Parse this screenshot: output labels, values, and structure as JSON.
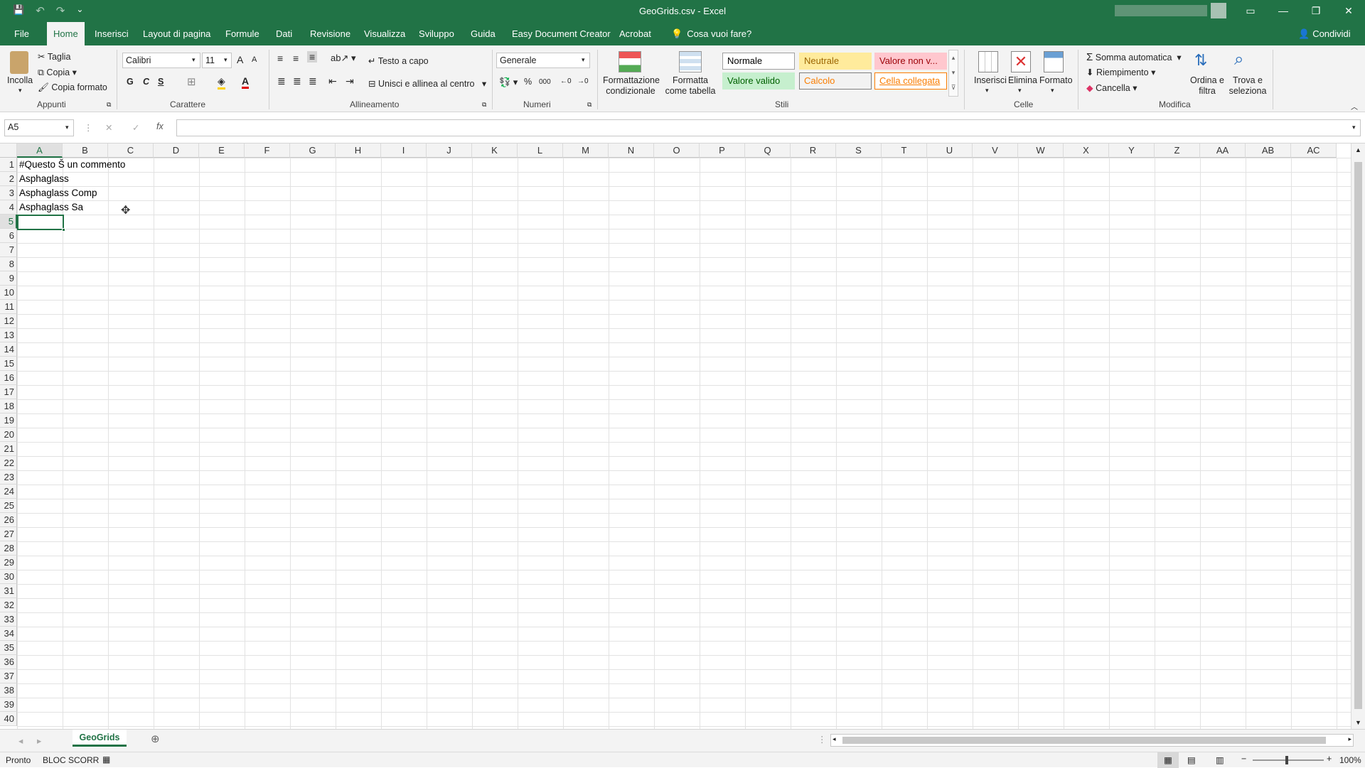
{
  "window": {
    "title": "GeoGrids.csv  -  Excel",
    "controls": {
      "ribbon_display": "▭",
      "minimize": "—",
      "restore": "❐",
      "close": "✕"
    }
  },
  "qat": {
    "save": "💾",
    "undo": "↶",
    "redo": "↷",
    "customize": "⌄"
  },
  "tabs": [
    "File",
    "Home",
    "Inserisci",
    "Layout di pagina",
    "Formule",
    "Dati",
    "Revisione",
    "Visualizza",
    "Sviluppo",
    "Guida",
    "Easy Document Creator",
    "Acrobat"
  ],
  "tell_me": "Cosa vuoi fare?",
  "share": "Condividi",
  "ribbon": {
    "clipboard": {
      "label": "Appunti",
      "paste": "Incolla",
      "cut": "Taglia",
      "copy": "Copia",
      "format_painter": "Copia formato"
    },
    "font": {
      "label": "Carattere",
      "name": "Calibri",
      "size": "11",
      "bold": "G",
      "italic": "C",
      "underline": "S",
      "grow": "A",
      "shrink": "A"
    },
    "alignment": {
      "label": "Allineamento",
      "wrap": "Testo a capo",
      "merge": "Unisci e allinea al centro"
    },
    "number": {
      "label": "Numeri",
      "format": "Generale",
      "percent": "%",
      "thousands": "000"
    },
    "styles": {
      "label": "Stili",
      "conditional": "Formattazione condizionale",
      "format_table": "Formatta come tabella",
      "cells": [
        {
          "name": "Normale",
          "bg": "#ffffff",
          "fg": "#000000",
          "border": "#a0a0a0"
        },
        {
          "name": "Neutrale",
          "bg": "#ffeb9c",
          "fg": "#9c6500",
          "border": "#ffeb9c"
        },
        {
          "name": "Valore non v...",
          "bg": "#ffc7ce",
          "fg": "#9c0006",
          "border": "#ffc7ce"
        },
        {
          "name": "Valore valido",
          "bg": "#c6efce",
          "fg": "#006100",
          "border": "#c6efce"
        },
        {
          "name": "Calcolo",
          "bg": "#f2f2f2",
          "fg": "#fa7d00",
          "border": "#7f7f7f"
        },
        {
          "name": "Cella collegata",
          "bg": "#ffffff",
          "fg": "#fa7d00",
          "border": "#fa7d00"
        }
      ]
    },
    "cells": {
      "label": "Celle",
      "insert": "Inserisci",
      "delete": "Elimina",
      "format": "Formato"
    },
    "editing": {
      "label": "Modifica",
      "autosum": "Somma automatica",
      "fill": "Riempimento",
      "clear": "Cancella",
      "sort": "Ordina e filtra",
      "find": "Trova e seleziona"
    }
  },
  "formula_bar": {
    "name_box": "A5",
    "formula": "",
    "fx": "fx",
    "cancel": "✕",
    "enter": "✓"
  },
  "columns": [
    "A",
    "B",
    "C",
    "D",
    "E",
    "F",
    "G",
    "H",
    "I",
    "J",
    "K",
    "L",
    "M",
    "N",
    "O",
    "P",
    "Q",
    "R",
    "S",
    "T",
    "U",
    "V",
    "W",
    "X",
    "Y",
    "Z",
    "AA",
    "AB",
    "AC"
  ],
  "rows": 40,
  "cells": [
    {
      "row": 1,
      "col": "A",
      "value": "#Questo Š un commento"
    },
    {
      "row": 2,
      "col": "A",
      "value": "Asphaglass"
    },
    {
      "row": 3,
      "col": "A",
      "value": "Asphaglass Comp"
    },
    {
      "row": 4,
      "col": "A",
      "value": "Asphaglass Sa"
    }
  ],
  "active_cell": {
    "row": 5,
    "col": "A"
  },
  "sheet_tabs": [
    "GeoGrids"
  ],
  "status": {
    "mode": "Pronto",
    "scroll_lock": "BLOC SCORR",
    "zoom": "100%",
    "zoom_minus": "−",
    "zoom_plus": "+"
  }
}
